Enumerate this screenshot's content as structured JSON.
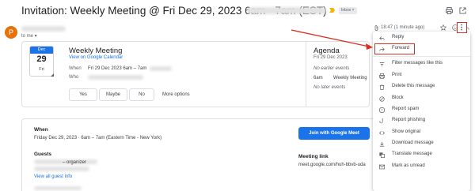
{
  "email": {
    "subject": "Invitation: Weekly Meeting @ Fri Dec 29, 2023 6am - 7am (EST)",
    "inbox_chip": "Inbox ×",
    "sender_initial": "P",
    "to_me": "to me",
    "timestamp": "18:47 (1 minute ago)"
  },
  "event": {
    "cal_month": "Dec",
    "cal_day": "29",
    "cal_dow": "Fri",
    "title": "Weekly Meeting",
    "view_link": "View on Google Calendar",
    "when_label": "When",
    "when_value": "Fri 29 Dec 2023 6am – 7am",
    "who_label": "Who",
    "rsvp_yes": "Yes",
    "rsvp_maybe": "Maybe",
    "rsvp_no": "No",
    "more_options": "More options"
  },
  "agenda": {
    "title": "Agenda",
    "date": "Fri 29 Dec 2023",
    "no_earlier": "No earlier events",
    "time": "6am",
    "event_name": "Weekly Meeting",
    "no_later": "No later events"
  },
  "menu": {
    "items": [
      {
        "label": "Reply",
        "icon": "reply-icon"
      },
      {
        "label": "Forward",
        "icon": "forward-icon"
      },
      {
        "label": "Filter messages like this",
        "icon": "filter-icon"
      },
      {
        "label": "Print",
        "icon": "print-icon"
      },
      {
        "label": "Delete this message",
        "icon": "trash-icon"
      },
      {
        "label": "Block",
        "icon": "block-icon"
      },
      {
        "label": "Report spam",
        "icon": "spam-icon"
      },
      {
        "label": "Report phishing",
        "icon": "phishing-icon"
      },
      {
        "label": "Show original",
        "icon": "code-icon"
      },
      {
        "label": "Download message",
        "icon": "download-icon"
      },
      {
        "label": "Translate message",
        "icon": "translate-icon"
      },
      {
        "label": "Mark as unread",
        "icon": "mail-icon"
      }
    ]
  },
  "details": {
    "when_label": "When",
    "when_value": "Friday Dec 29, 2023 · 6am – 7am (Eastern Time - New York)",
    "join_button": "Join with Google Meet",
    "guests_label": "Guests",
    "organizer": "– organizer",
    "view_guests": "View all guest info",
    "meeting_link_label": "Meeting link",
    "meeting_link": "meet.google.com/huh-bbvb-uda"
  },
  "colors": {
    "accent": "#1a73e8",
    "annotation": "#d93025",
    "avatar": "#e8710a"
  }
}
